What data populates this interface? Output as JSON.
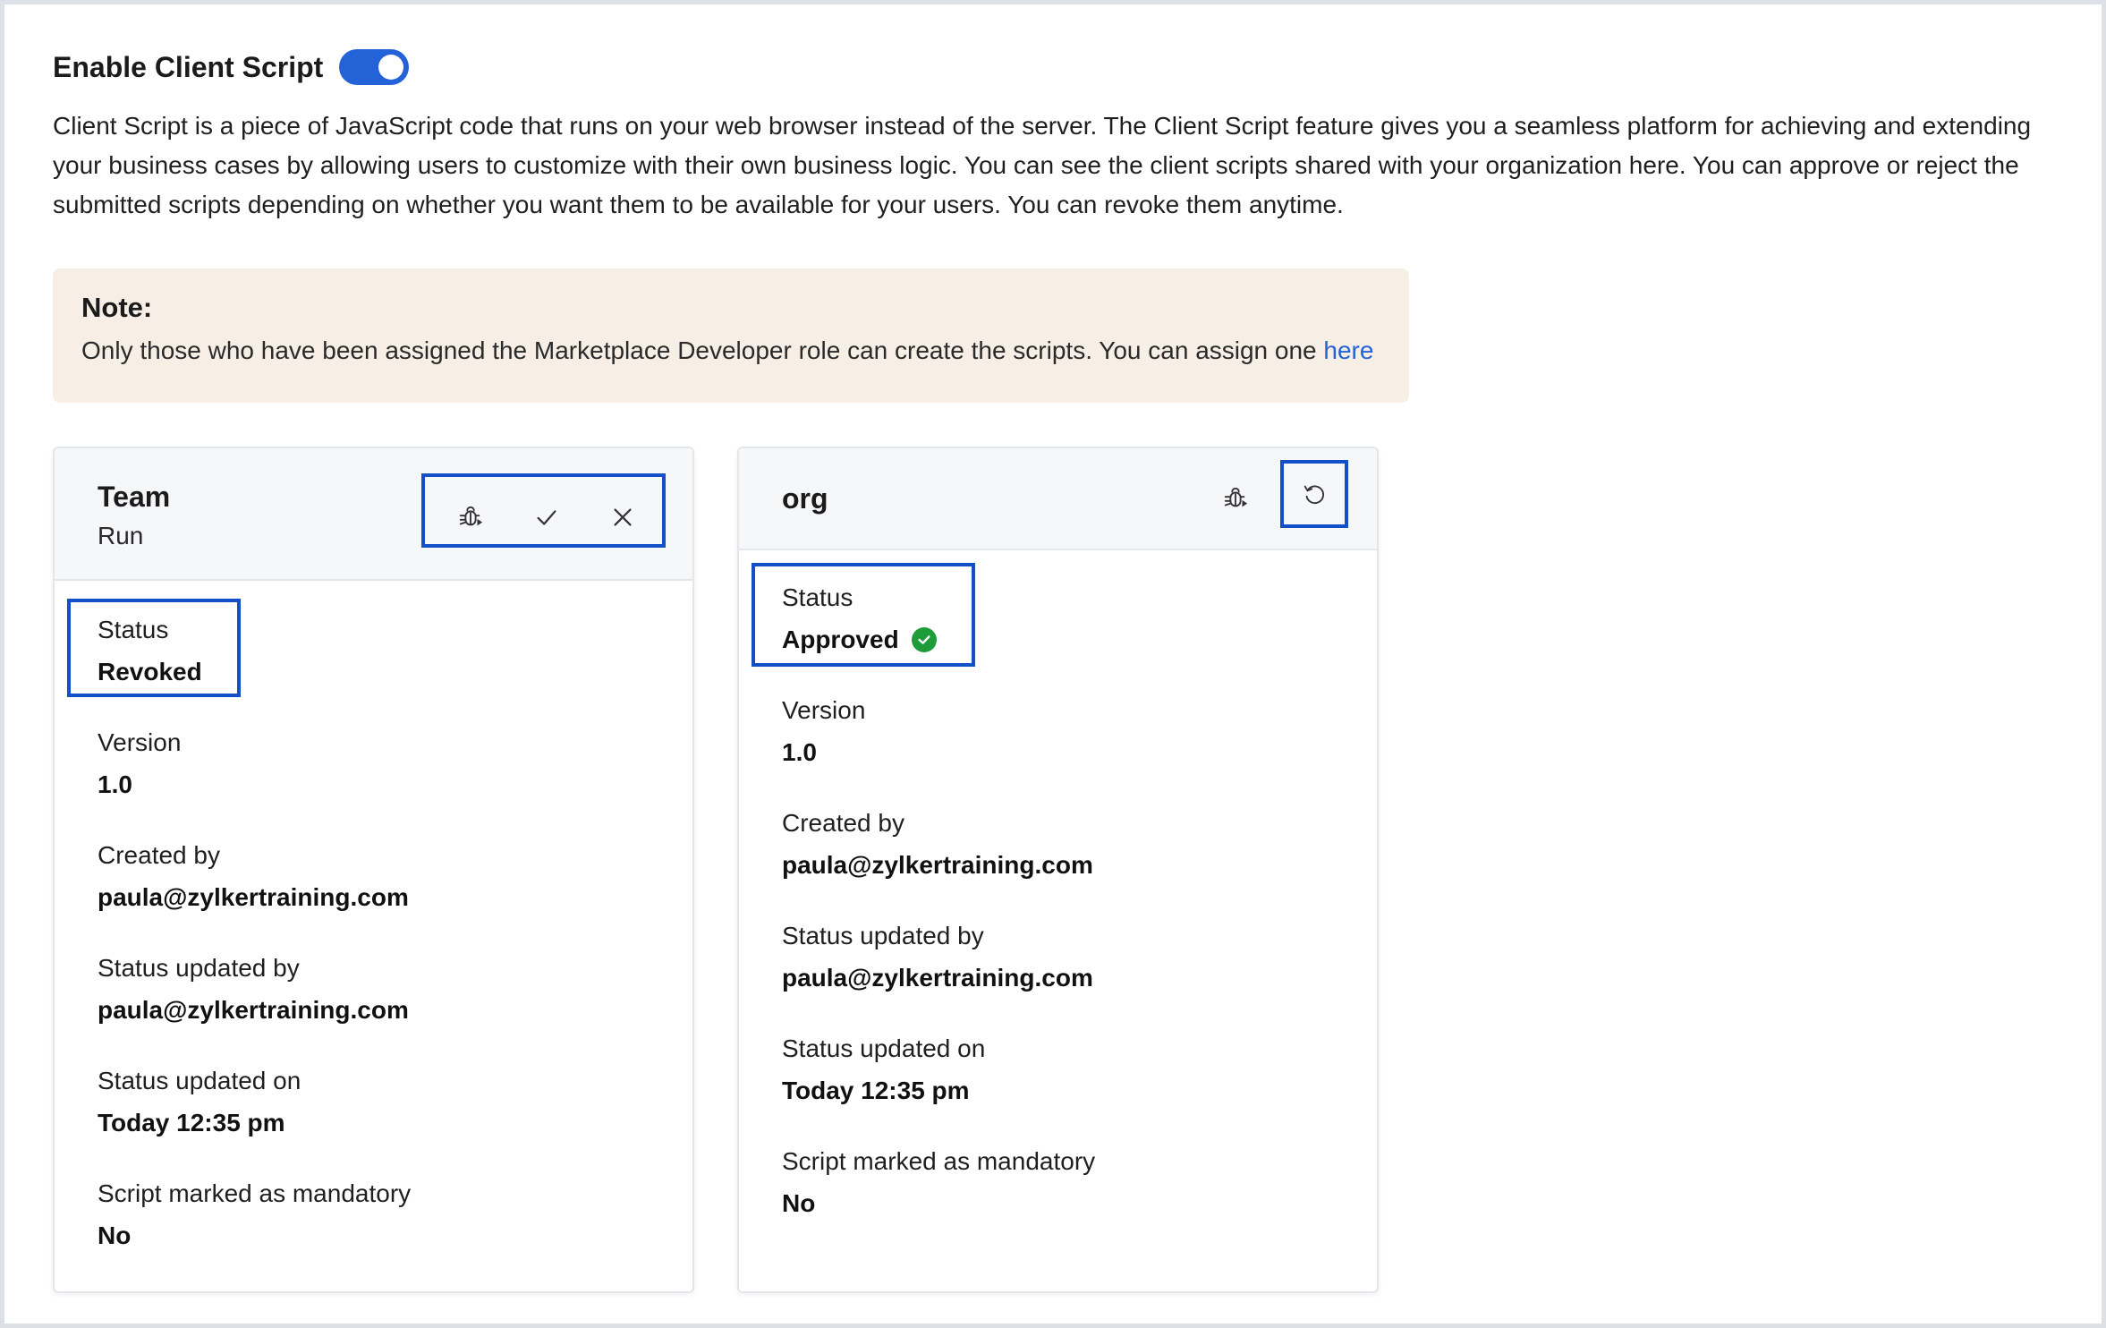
{
  "header": {
    "enable_label": "Enable Client Script",
    "toggle_on": true
  },
  "description": "Client Script is a piece of JavaScript code that runs on your web browser instead of the server. The Client Script feature gives you a seamless platform for achieving and extending your business cases by allowing users to customize with their own business logic. You can see the client scripts shared with your organization here. You can approve or reject the submitted scripts depending on whether you want them to be available for your users. You can revoke them anytime.",
  "note": {
    "title": "Note:",
    "text": "Only those who have been assigned the Marketplace Developer role can create the scripts. You can assign one ",
    "link": "here"
  },
  "cards": [
    {
      "title": "Team",
      "subtitle": "Run",
      "icons": [
        "bug-icon",
        "check-icon",
        "close-icon"
      ],
      "fields": [
        {
          "label": "Status",
          "value": "Revoked"
        },
        {
          "label": "Version",
          "value": "1.0"
        },
        {
          "label": "Created by",
          "value": "paula@zylkertraining.com"
        },
        {
          "label": "Status updated by",
          "value": "paula@zylkertraining.com"
        },
        {
          "label": "Status updated on",
          "value": "Today 12:35 pm"
        },
        {
          "label": "Script marked as mandatory",
          "value": "No"
        }
      ]
    },
    {
      "title": "org",
      "icons": [
        "bug-icon",
        "revoke-icon"
      ],
      "fields": [
        {
          "label": "Status",
          "value": "Approved",
          "badge": "approved-check-icon"
        },
        {
          "label": "Version",
          "value": "1.0"
        },
        {
          "label": "Created by",
          "value": "paula@zylkertraining.com"
        },
        {
          "label": "Status updated by",
          "value": "paula@zylkertraining.com"
        },
        {
          "label": "Status updated on",
          "value": "Today 12:35 pm"
        },
        {
          "label": "Script marked as mandatory",
          "value": "No"
        }
      ]
    }
  ],
  "colors": {
    "accent": "#2462d8",
    "highlight": "#1350c8",
    "note_bg": "#f7efe6",
    "approved": "#1e9c3a"
  }
}
